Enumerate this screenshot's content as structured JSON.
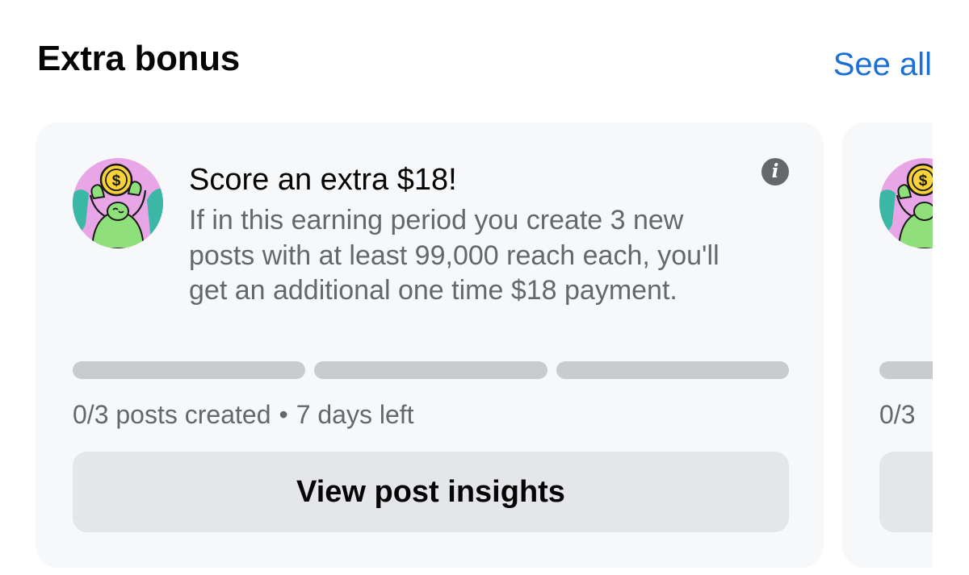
{
  "section": {
    "title": "Extra bonus",
    "see_all_label": "See all"
  },
  "cards": [
    {
      "avatar_icon": "coin-hands-illustration",
      "title": "Score an extra $18!",
      "description": "If in this earning period you create 3 new posts with at least 99,000 reach each, you'll get an additional one time $18 payment.",
      "info_icon": "info-icon",
      "progress": {
        "completed": 0,
        "total": 3
      },
      "status": {
        "posts": "0/3 posts created",
        "separator": "•",
        "time_left": "7 days left"
      },
      "cta_label": "View post insights"
    },
    {
      "avatar_icon": "coin-hands-illustration",
      "status": {
        "posts": "0/3"
      }
    }
  ],
  "colors": {
    "accent": "#1b6fd6",
    "card_background": "#f7f8fa",
    "secondary_text": "#65676b",
    "progress_track": "#c9cbce",
    "button_background": "#e4e6e9"
  }
}
